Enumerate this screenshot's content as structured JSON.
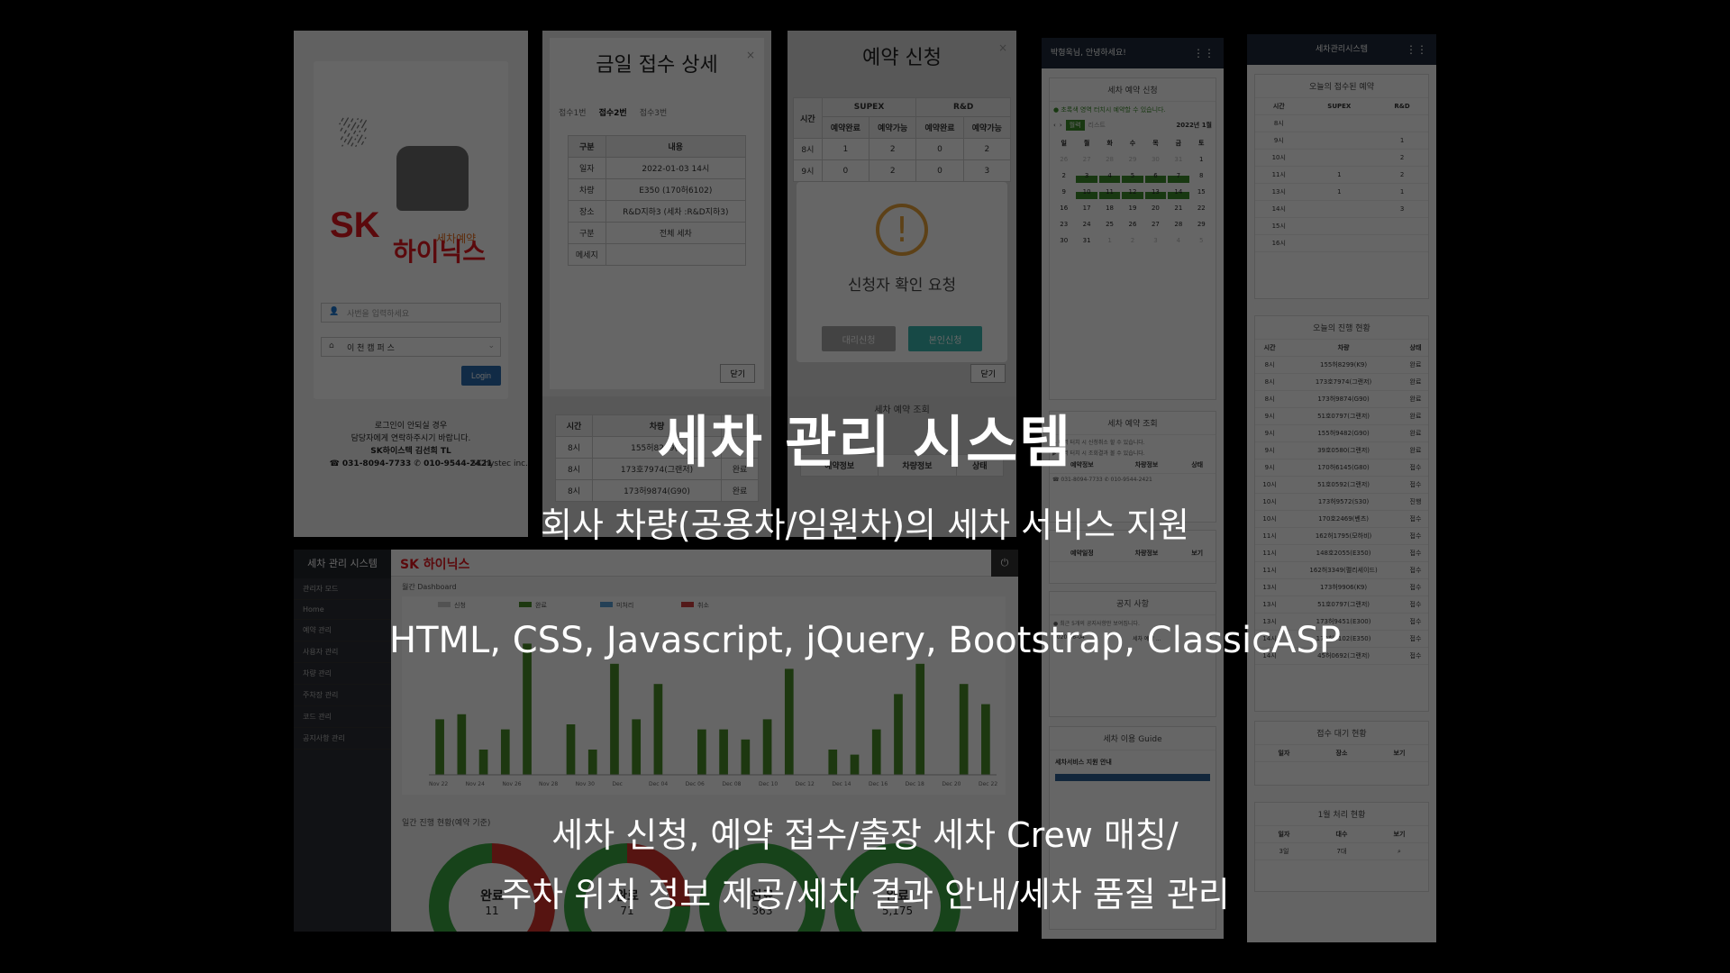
{
  "headline": {
    "title": "세차 관리 시스템",
    "subtitle": "회사 차량(공용차/임원차)의 세차 서비스 지원",
    "tech": "HTML, CSS, Javascript, jQuery, Bootstrap, ClassicASP",
    "features_line1": "세차 신청, 예약 접수/출장 세차 Crew 매칭/",
    "features_line2": "주차 위치 정보 제공/세차 결과 안내/세차 품질 관리"
  },
  "login": {
    "logo_sk": "SK",
    "logo_name": "하이닉스",
    "logo_sub": "세차예약",
    "id_placeholder": "사번을 입력하세요",
    "site_value": "이 천 캠 퍼 스",
    "login_button": "Login",
    "help_line1": "로그인이 안되실 경우",
    "help_line2": "담당자에게 연락하주시기 바랍니다.",
    "help_line3": "SK하이스텍 김선희 TL",
    "help_line4": "☎ 031-8094-7733  ✆ 010-9544-2421",
    "footer": "SK hystec inc."
  },
  "detail": {
    "title": "금일 접수 상세",
    "tabs": [
      "접수1번",
      "접수2번",
      "접수3번"
    ],
    "rows": [
      {
        "k": "구분",
        "v": "내용"
      },
      {
        "k": "일자",
        "v": "2022-01-03 14시"
      },
      {
        "k": "차량",
        "v": "E350 (170허6102)"
      },
      {
        "k": "장소",
        "v": "R&D지하3 (세차 :R&D지하3)"
      },
      {
        "k": "구분",
        "v": "전체 세차"
      },
      {
        "k": "메세지",
        "v": ""
      }
    ],
    "close": "닫기"
  },
  "detail_list": {
    "headers": [
      "시간",
      "차량",
      ""
    ],
    "rows": [
      [
        "8시",
        "155허8299(K",
        ""
      ],
      [
        "8시",
        "173호7974(그랜저)",
        "완료"
      ],
      [
        "8시",
        "173허9874(G90)",
        "완료"
      ]
    ]
  },
  "booking": {
    "title": "예약 신청",
    "groups": [
      "SUPEX",
      "R&D"
    ],
    "subheaders": [
      "시간",
      "예약완료",
      "예약가능",
      "예약완료",
      "예약가능"
    ],
    "rows": [
      [
        "8시",
        "1",
        "2",
        "0",
        "2"
      ],
      [
        "9시",
        "0",
        "2",
        "0",
        "3"
      ]
    ],
    "alert_text": "신청자 확인 요청",
    "btn_proxy": "대리신청",
    "btn_self": "본인신청",
    "close": "닫기",
    "lower_title": "세차 예약 조회",
    "lower_headers": [
      "예약정보",
      "차량정보",
      "상태"
    ]
  },
  "calendar": {
    "header": "박형욱님, 안녕하세요!",
    "section_title": "세차 예약 신청",
    "notice": "● 초록색 영역 터치시 예약할 수 있습니다.",
    "month_label": "2022년 1월",
    "view_month": "월력",
    "view_list": "리스트",
    "weekdays": [
      "일",
      "월",
      "화",
      "수",
      "목",
      "금",
      "토"
    ],
    "days": [
      [
        "26",
        "27",
        "28",
        "29",
        "30",
        "31",
        "1"
      ],
      [
        "2",
        "3",
        "4",
        "5",
        "6",
        "7",
        "8"
      ],
      [
        "9",
        "10",
        "11",
        "12",
        "13",
        "14",
        "15"
      ],
      [
        "16",
        "17",
        "18",
        "19",
        "20",
        "21",
        "22"
      ],
      [
        "23",
        "24",
        "25",
        "26",
        "27",
        "28",
        "29"
      ],
      [
        "30",
        "31",
        "1",
        "2",
        "3",
        "4",
        "5"
      ]
    ],
    "inquiry_title": "세차 예약 조회",
    "inquiry_note1": "▶ 내역 터치 시 신청취소 할 수 있습니다.",
    "inquiry_note2": "▶ 내역 터치 시 조회결과 볼 수 있습니다.",
    "inquiry_headers": [
      "예약정보",
      "차량정보",
      "상태"
    ],
    "inquiry_contact": "☎ 031-8094-7733  ✆ 010-9544-2421",
    "hist_headers": [
      "예약일정",
      "차량정보",
      "보기"
    ],
    "notice_title": "공지 사항",
    "notice_note": "● 최근 5개의 공지사항만 보여집니다.",
    "notice_date": "2020-06-04",
    "notice_subject": "세차 예약 ...",
    "guide_title": "세차 이용 Guide",
    "guide_sub": "세차서비스 지원 안내"
  },
  "list": {
    "header": "세차관리시스템",
    "today_title": "오늘의 접수된 예약",
    "today_headers": [
      "시간",
      "SUPEX",
      "R&D"
    ],
    "today_rows": [
      [
        "8시",
        "",
        ""
      ],
      [
        "9시",
        "",
        "1"
      ],
      [
        "10시",
        "",
        "2"
      ],
      [
        "11시",
        "1",
        "2"
      ],
      [
        "13시",
        "1",
        "1"
      ],
      [
        "14시",
        "",
        "3"
      ],
      [
        "15시",
        "",
        ""
      ],
      [
        "16시",
        "",
        ""
      ]
    ],
    "progress_title": "오늘의 진행 현황",
    "progress_headers": [
      "시간",
      "차량",
      "상태"
    ],
    "progress_rows": [
      [
        "8시",
        "155허8299(K9)",
        "완료"
      ],
      [
        "8시",
        "173호7974(그랜저)",
        "완료"
      ],
      [
        "8시",
        "173허9874(G90)",
        "완료"
      ],
      [
        "9시",
        "51호0797(그랜저)",
        "완료"
      ],
      [
        "9시",
        "155허9482(G90)",
        "완료"
      ],
      [
        "9시",
        "39호0580(그랜저)",
        "완료"
      ],
      [
        "9시",
        "170허6145(G80)",
        "접수"
      ],
      [
        "10시",
        "51호0592(그랜저)",
        "접수"
      ],
      [
        "10시",
        "173허9572(S30)",
        "진행"
      ],
      [
        "10시",
        "170호2469(벤츠)",
        "접수"
      ],
      [
        "11시",
        "162허1795(모하비)",
        "접수"
      ],
      [
        "11시",
        "148호2055(E350)",
        "접수"
      ],
      [
        "11시",
        "162허3349(펠리세이드)",
        "접수"
      ],
      [
        "13시",
        "173허9906(K9)",
        "접수"
      ],
      [
        "13시",
        "51호0797(그랜저)",
        "접수"
      ],
      [
        "13시",
        "173허9451(E300)",
        "접수"
      ],
      [
        "14시",
        "170허6102(E350)",
        "접수"
      ],
      [
        "14시",
        "45허0692(그랜저)",
        "접수"
      ]
    ],
    "wait_title": "접수 대기 현황",
    "wait_headers": [
      "일자",
      "장소",
      "보기"
    ],
    "month_title": "1월 처리 현황",
    "month_headers": [
      "일자",
      "대수",
      "보기"
    ],
    "month_row": [
      "3일",
      "7대",
      ""
    ]
  },
  "dashboard": {
    "brand": "세차 관리 시스템",
    "sk": "SK 하이닉스",
    "nav": [
      "관리자 모드",
      "Home",
      "예약 관리",
      "사용자 관리",
      "차량 관리",
      "주차장 관리",
      "코드 관리",
      "공지사항 관리"
    ],
    "chart_label": "월간 Dashboard",
    "legend": [
      "신청",
      "완료",
      "미처리",
      "취소"
    ],
    "xlabels": [
      "Nov 22",
      "Nov 24",
      "Nov 26",
      "Nov 28",
      "Nov 30",
      "Dec",
      "Dec 04",
      "Dec 06",
      "Dec 08",
      "Dec 10",
      "Dec 12",
      "Dec 14",
      "Dec 16",
      "Dec 18",
      "Dec 20",
      "Dec 22"
    ],
    "bars": [
      22,
      24,
      10,
      18,
      52,
      0,
      20,
      10,
      44,
      22,
      36,
      0,
      18,
      18,
      14,
      22,
      42,
      0,
      10,
      8,
      18,
      32,
      44,
      0,
      36,
      28
    ],
    "progress_label": "일간 진행 현황(예약 기준)",
    "donuts": [
      {
        "label": "완료",
        "value": "11",
        "red": 0.35,
        "color_main": "#3aa843",
        "color_alt": "#d6342c"
      },
      {
        "label": "완료",
        "value": "71",
        "red": 0.25,
        "color_main": "#3aa843",
        "color_alt": "#d6342c"
      },
      {
        "label": "완료",
        "value": "363",
        "red": 0.0,
        "color_main": "#3aa843",
        "color_alt": "#d6342c"
      },
      {
        "label": "완료",
        "value": "5,175",
        "red": 0.0,
        "color_main": "#3aa843",
        "color_alt": "#d6342c"
      }
    ]
  }
}
